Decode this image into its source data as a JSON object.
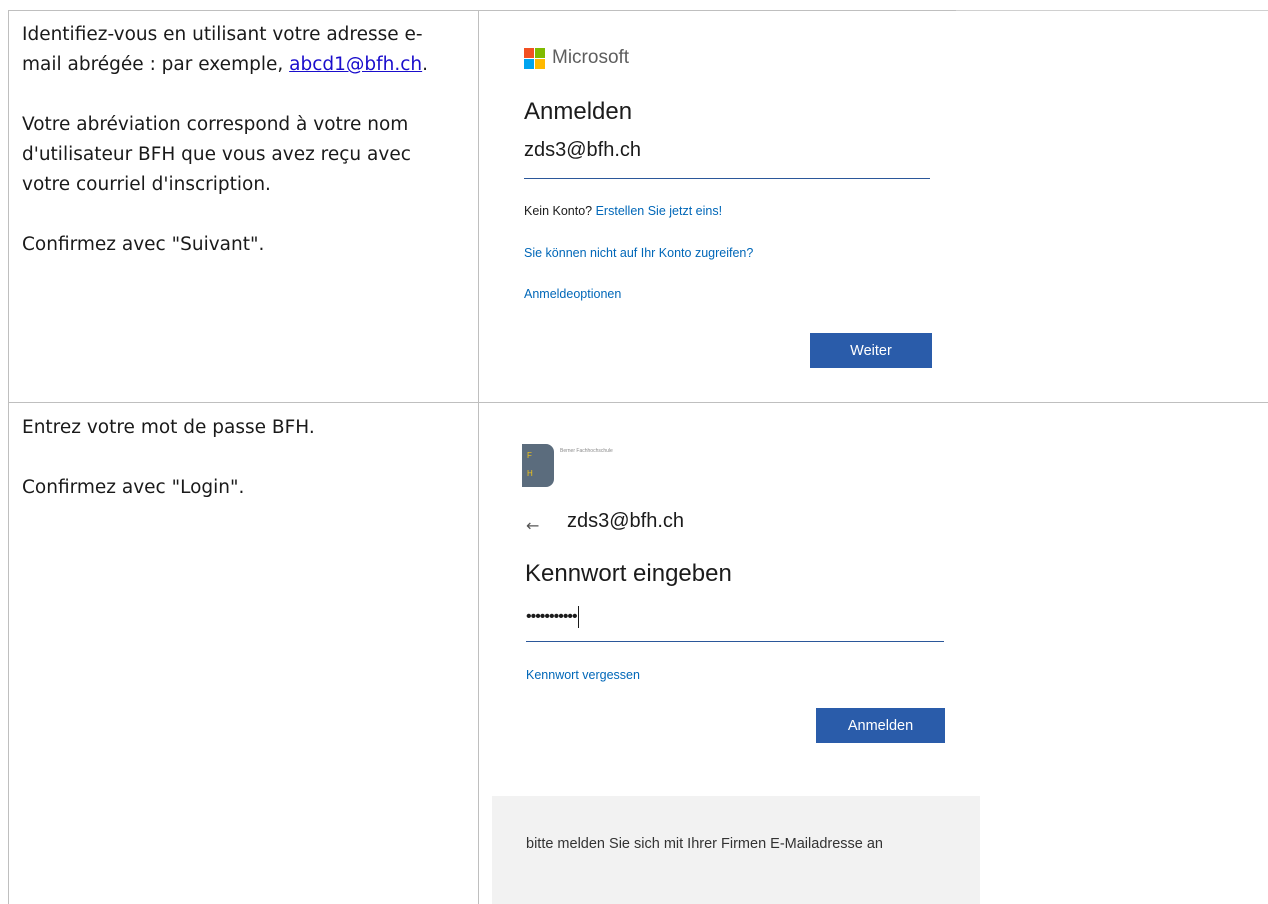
{
  "row1": {
    "instructions": {
      "line1": "Identifiez-vous en utilisant votre adresse e-mail abrégée : par exemple, ",
      "example_link": "abcd1@bfh.ch",
      "line1_end": ".",
      "para2": "Votre abréviation correspond à votre nom d'utilisateur BFH que vous avez reçu avec votre courriel d'inscription.",
      "para3": "Confirmez avec \"Suivant\"."
    },
    "screenshot": {
      "brand": "Microsoft",
      "title": "Anmelden",
      "username_value": "zds3@bfh.ch",
      "no_account_text": "Kein Konto?",
      "create_link": "Erstellen Sie jetzt eins!",
      "cant_access_link": "Sie können nicht auf Ihr Konto zugreifen?",
      "signin_options_link": "Anmeldeoptionen",
      "next_button": "Weiter",
      "logo_colors": [
        "#f25022",
        "#7fba00",
        "#00a4ef",
        "#ffb900"
      ]
    }
  },
  "row2": {
    "instructions": {
      "para1": "Entrez votre mot de passe BFH.",
      "para2": "Confirmez avec \"Login\"."
    },
    "screenshot": {
      "logo_letters": [
        "F",
        "H"
      ],
      "logo_text": "Berner Fachhochschule",
      "back_arrow": "←",
      "identity": "zds3@bfh.ch",
      "title": "Kennwort eingeben",
      "password_value": "•••••••••••",
      "forgot_link": "Kennwort vergessen",
      "signin_button": "Anmelden",
      "footer_text": "bitte melden Sie sich mit Ihrer Firmen E-Mailadresse an"
    }
  }
}
